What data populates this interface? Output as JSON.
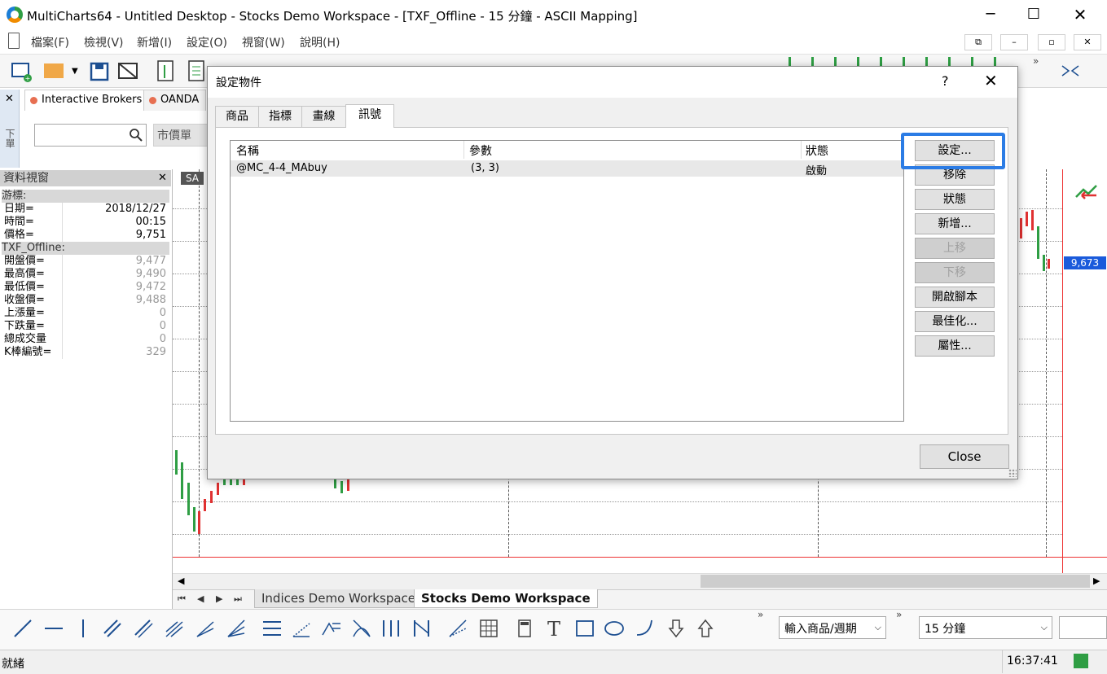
{
  "window": {
    "title": "MultiCharts64 - Untitled Desktop - Stocks Demo Workspace - [TXF_Offline - 15 分鐘 - ASCII Mapping]"
  },
  "menu": [
    "檔案(F)",
    "檢視(V)",
    "新增(I)",
    "設定(O)",
    "視窗(W)",
    "說明(H)"
  ],
  "order_panel": {
    "side_label": "下單",
    "broker_tabs": [
      "Interactive Brokers",
      "OANDA"
    ],
    "order_type": "市價單"
  },
  "data_view": {
    "title": "資料視窗",
    "sections": [
      {
        "label": "游標:",
        "rows": [
          [
            "日期=",
            "2018/12/27"
          ],
          [
            "時間=",
            "00:15"
          ],
          [
            "價格=",
            "9,751"
          ]
        ]
      },
      {
        "label": "TXF_Offline:",
        "rows": [
          [
            "開盤價=",
            "9,477"
          ],
          [
            "最高價=",
            "9,490"
          ],
          [
            "最低價=",
            "9,472"
          ],
          [
            "收盤價=",
            "9,488"
          ],
          [
            "上漲量=",
            "0"
          ],
          [
            "下跌量=",
            "0"
          ],
          [
            "總成交量",
            "0"
          ],
          [
            "K棒編號=",
            "329"
          ]
        ]
      }
    ]
  },
  "chart": {
    "label": "SA",
    "last_price": "9,673",
    "accent": "#1a5adb"
  },
  "workspace_tabs": [
    "Indices Demo Workspace",
    "Stocks Demo Workspace"
  ],
  "drawing_bar": {
    "symbol_placeholder": "輸入商品/週期",
    "interval": "15 分鐘"
  },
  "status": {
    "text": "就緒",
    "clock": "16:37:41"
  },
  "dialog": {
    "title": "設定物件",
    "help": "?",
    "tabs": [
      "商品",
      "指標",
      "畫線",
      "訊號"
    ],
    "active_tab": 3,
    "columns": [
      "名稱",
      "參數",
      "狀態"
    ],
    "rows": [
      {
        "name": "@MC_4-4_MAbuy",
        "params": "(3, 3)",
        "status": "啟動"
      }
    ],
    "buttons": [
      {
        "label": "設定...",
        "enabled": true
      },
      {
        "label": "移除",
        "enabled": true
      },
      {
        "label": "狀態",
        "enabled": true
      },
      {
        "label": "新增...",
        "enabled": true
      },
      {
        "label": "上移",
        "enabled": false
      },
      {
        "label": "下移",
        "enabled": false
      },
      {
        "label": "開啟腳本",
        "enabled": true
      },
      {
        "label": "最佳化...",
        "enabled": true
      },
      {
        "label": "屬性...",
        "enabled": true
      }
    ],
    "close_label": "Close",
    "highlight_color": "#2b7ce5"
  }
}
